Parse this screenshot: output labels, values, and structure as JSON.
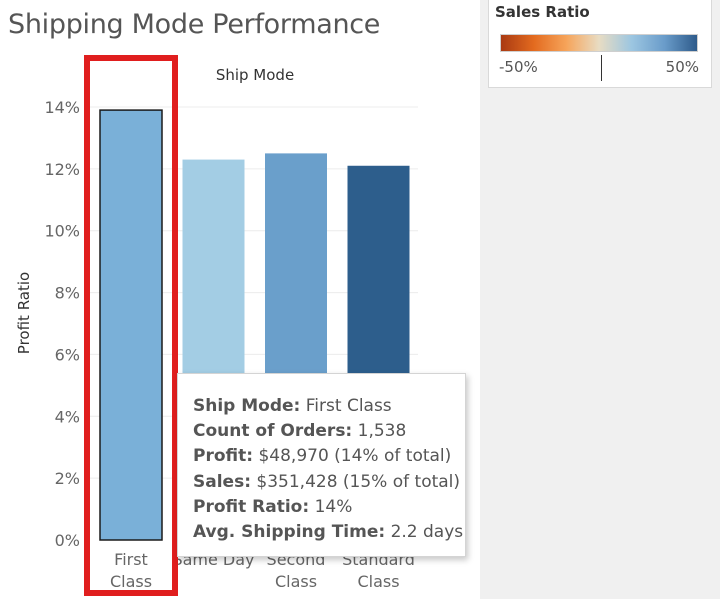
{
  "title": "Shipping Mode Performance",
  "legend": {
    "title": "Sales Ratio",
    "min_label": "-50%",
    "max_label": "50%",
    "colors": [
      "#a93a12",
      "#e36a1f",
      "#f6a45a",
      "#e8dcc3",
      "#9cc6e1",
      "#6a9cca",
      "#2e5b8b"
    ]
  },
  "chart_data": {
    "type": "bar",
    "title": "Shipping Mode Performance",
    "column_header": "Ship Mode",
    "ylabel": "Profit Ratio",
    "ylim": [
      0,
      14
    ],
    "yticks": [
      0,
      2,
      4,
      6,
      8,
      10,
      12,
      14
    ],
    "ytick_labels": [
      "0%",
      "2%",
      "4%",
      "6%",
      "8%",
      "10%",
      "12%",
      "14%"
    ],
    "grid": true,
    "categories": [
      [
        "First",
        "Class"
      ],
      [
        "Same Day"
      ],
      [
        "Second",
        "Class"
      ],
      [
        "Standard",
        "Class"
      ]
    ],
    "values": [
      13.9,
      12.3,
      12.5,
      12.1
    ],
    "colors": [
      "#7ab0d8",
      "#a3cde4",
      "#6a9fcb",
      "#2d5e8c"
    ],
    "selected_index": 0
  },
  "tooltip": {
    "lines": [
      {
        "key": "Ship Mode:",
        "value": "First Class"
      },
      {
        "key": "Count of Orders:",
        "value": "1,538"
      },
      {
        "key": "Profit:",
        "value": "$48,970 (14% of total)"
      },
      {
        "key": "Sales:",
        "value": "$351,428 (15% of total)"
      },
      {
        "key": "Profit Ratio:",
        "value": "14%"
      },
      {
        "key": "Avg. Shipping Time:",
        "value": "2.2 days"
      }
    ]
  }
}
